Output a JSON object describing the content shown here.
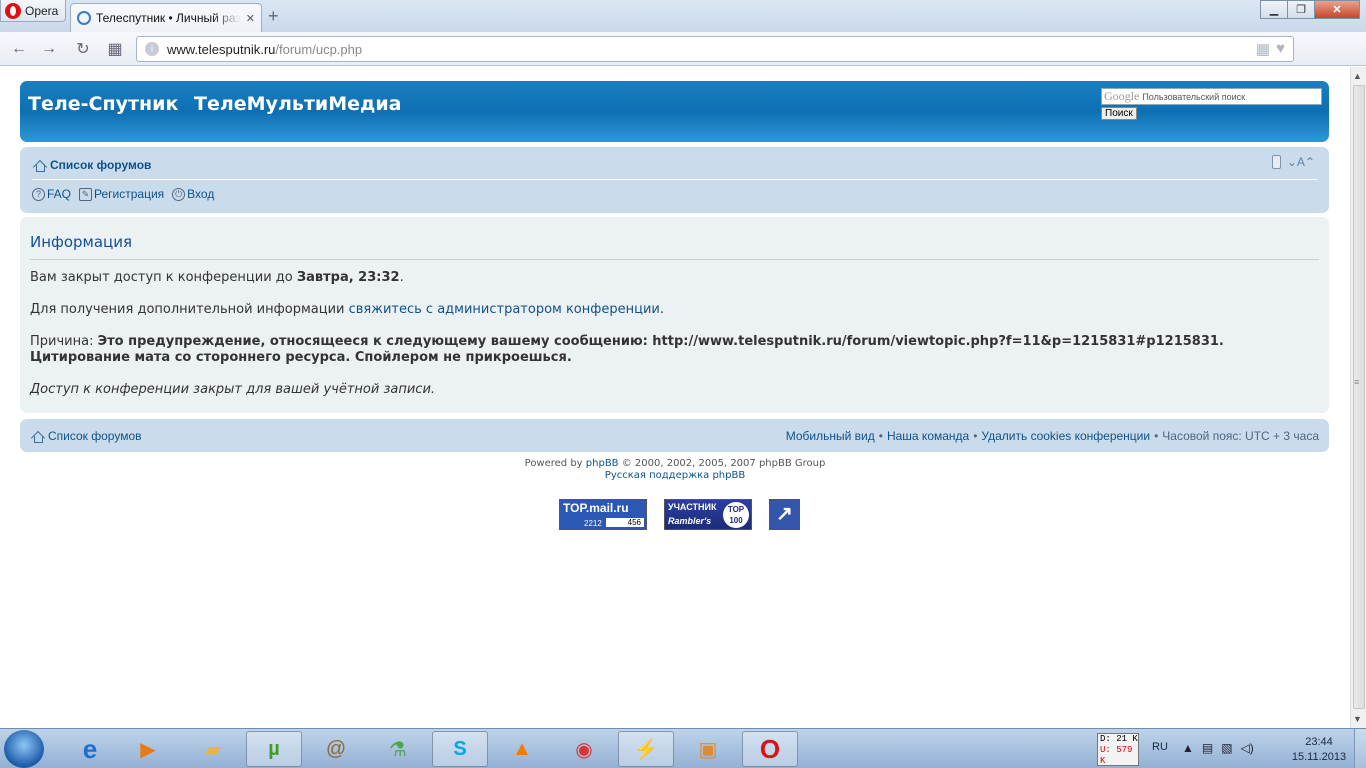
{
  "browser": {
    "menu_label": "Opera",
    "tab_title": "Телеспутник • Личный раздел",
    "url_domain": "www.telesputnik.ru",
    "url_path": "/forum/ucp.php"
  },
  "header": {
    "site_name_1": "Теле-Спутник",
    "site_name_2": "ТелеМультиМедиа",
    "search_logo": "Google",
    "search_placeholder": "Пользовательский поиск",
    "search_button": "Поиск"
  },
  "nav": {
    "breadcrumb": "Список форумов",
    "font_control": "A",
    "links": [
      {
        "label": "FAQ"
      },
      {
        "label": "Регистрация"
      },
      {
        "label": "Вход"
      }
    ]
  },
  "content": {
    "title": "Информация",
    "line1_prefix": "Вам закрыт доступ к конференции до ",
    "line1_bold": "Завтра, 23:32",
    "line1_suffix": ".",
    "line2_prefix": "Для получения дополнительной информации ",
    "line2_link": "свяжитесь с администратором конференции",
    "line2_suffix": ".",
    "reason_label": "Причина: ",
    "reason_text": "Это предупреждение, относящееся к следующему вашему сообщению: http://www.telesputnik.ru/forum/viewtopic.php?f=11&p=1215831#p1215831. Цитирование мата со стороннего ресурса. Спойлером не прикроешься.",
    "closed_note": "Доступ к конференции закрыт для вашей учётной записи."
  },
  "footer": {
    "breadcrumb": "Список форумов",
    "links": [
      "Мобильный вид",
      "Наша команда",
      "Удалить cookies конференции"
    ],
    "timezone": "Часовой пояс: UTC + 3 часа",
    "powered_prefix": "Powered by ",
    "powered_link": "phpBB",
    "powered_suffix": " © 2000, 2002, 2005, 2007 phpBB Group",
    "support_link": "Русская поддержка phpBB"
  },
  "counters": {
    "mail_label": "TOP.mail.ru",
    "mail_v1": "2212",
    "mail_v2": "456",
    "rambler_l1": "УЧАСТНИК",
    "rambler_l2": "Rambler's",
    "rambler_badge": "TOP 100",
    "li_glyph": "↗"
  },
  "taskbar": {
    "net_down": "D: 21 K",
    "net_up": "U: 579 K",
    "lang": "RU",
    "time": "23:44",
    "date": "15.11.2013"
  }
}
